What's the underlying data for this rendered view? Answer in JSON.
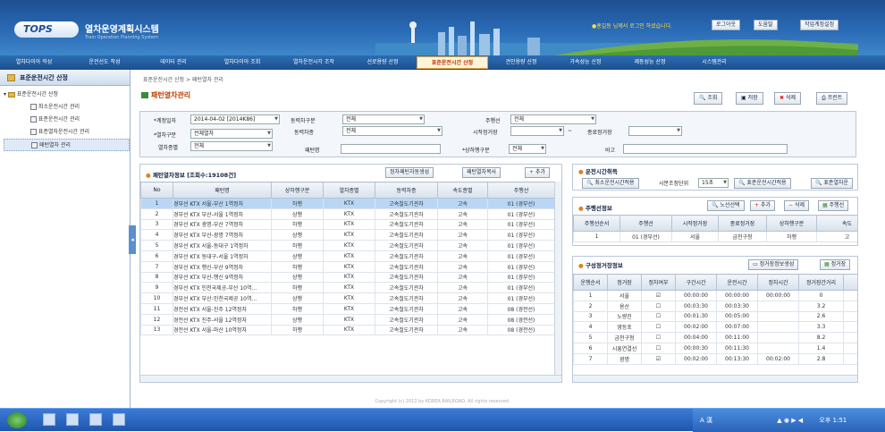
{
  "header": {
    "logo": "TOPS",
    "app_name": "열차운영계획시스템",
    "app_sub": "Train Operation Planning System",
    "welcome": "●홍길동 님께서 로그인 하셨습니다.",
    "buttons": [
      "로그아웃",
      "도움말",
      "작업계정설정"
    ]
  },
  "nav": {
    "items": [
      "열차다이아 작성",
      "운전선도 작성",
      "데이터 관리",
      "열차다이아 조회",
      "열차운전시각 조작",
      "선로용량 산정",
      "표준운전시간 산정",
      "견인용량 산정",
      "가속성능 산정",
      "제동성능 산정",
      "시스템관리"
    ],
    "active_index": 6
  },
  "sidebar": {
    "title": "표준운전시간 산정",
    "items": [
      {
        "label": "표준운전시간 산정",
        "level": 0
      },
      {
        "label": "최소운전시간 관리",
        "level": 1
      },
      {
        "label": "표준운전시간 관리",
        "level": 1
      },
      {
        "label": "표준열차운전시간 관리",
        "level": 1
      },
      {
        "label": "패턴열차 관리",
        "level": 1,
        "selected": true
      }
    ]
  },
  "breadcrumb": "표준운전시간 산정 > 패턴열차 관리",
  "page_title": "패턴열차관리",
  "toolbar": [
    "조회",
    "저장",
    "삭제",
    "프린트"
  ],
  "filter": {
    "date_label": "*계정일자",
    "date_value": "2014-04-02 [2014K86]",
    "train_type_label": "*열차구분",
    "train_type_value": "전체열차",
    "class_label": "열차종별",
    "class_value": "전체",
    "power_type_label": "동력차구분",
    "power_type_value": "전체",
    "power_car_label": "동력차종",
    "power_car_value": "전체",
    "pattern_label": "패턴명",
    "pattern_value": "",
    "line_label": "주행선",
    "line_value": "전체",
    "start_label": "시작정거장",
    "start_value": "",
    "end_label": "종료정거장",
    "end_value": "",
    "dir_label": "*상하행구분",
    "dir_value": "전체",
    "note_label": "비고",
    "note_value": ""
  },
  "pattern_panel": {
    "title": "패턴열차정보 [조회수:19108건]",
    "buttons": [
      "정차패턴자동생성",
      "패턴열차복사",
      "추가"
    ],
    "columns": [
      "No",
      "패턴명",
      "상하행구분",
      "열차종별",
      "동력차종",
      "속도종별",
      "주행선"
    ],
    "rows": [
      [
        "1",
        "경부선 KTX 서울-부산 1역정차",
        "하행",
        "KTX",
        "고속철도기관차",
        "고속",
        "01 (경부선)"
      ],
      [
        "2",
        "경부선 KTX 부산-서울 1역정차",
        "상행",
        "KTX",
        "고속철도기관차",
        "고속",
        "01 (경부선)"
      ],
      [
        "3",
        "경부선 KTX 광명-부산 7역정차",
        "하행",
        "KTX",
        "고속철도기관차",
        "고속",
        "01 (경부선)"
      ],
      [
        "4",
        "경부선 KTX 부산-광명 7역정차",
        "상행",
        "KTX",
        "고속철도기관차",
        "고속",
        "01 (경부선)"
      ],
      [
        "5",
        "경부선 KTX 서울-동대구 1역정차",
        "하행",
        "KTX",
        "고속철도기관차",
        "고속",
        "01 (경부선)"
      ],
      [
        "6",
        "경부선 KTX 동대구-서울 1역정차",
        "상행",
        "KTX",
        "고속철도기관차",
        "고속",
        "01 (경부선)"
      ],
      [
        "7",
        "경부선 KTX 행신-부산 9역정차",
        "하행",
        "KTX",
        "고속철도기관차",
        "고속",
        "01 (경부선)"
      ],
      [
        "8",
        "경부선 KTX 부산-행신 9역정차",
        "상행",
        "KTX",
        "고속철도기관차",
        "고속",
        "01 (경부선)"
      ],
      [
        "9",
        "경부선 KTX 인천국제공-부산 10역...",
        "하행",
        "KTX",
        "고속철도기관차",
        "고속",
        "01 (경부선)"
      ],
      [
        "10",
        "경부선 KTX 부산-인천국제공 10역...",
        "상행",
        "KTX",
        "고속철도기관차",
        "고속",
        "01 (경부선)"
      ],
      [
        "11",
        "경전선 KTX 서울-진주 12역정차",
        "하행",
        "KTX",
        "고속철도기관차",
        "고속",
        "08 (경전선)"
      ],
      [
        "12",
        "경전선 KTX 진주-서울 12역정차",
        "상행",
        "KTX",
        "고속철도기관차",
        "고속",
        "08 (경전선)"
      ],
      [
        "13",
        "경전선 KTX 서울-마산 10역정차",
        "하행",
        "KTX",
        "고속철도기관차",
        "고속",
        "08 (경전선)"
      ]
    ]
  },
  "run_time_panel": {
    "title": "운전시간취득",
    "buttons": [
      "최소운전시간적용",
      "표준운전시간적용",
      "표준열차운"
    ],
    "unit_label": "시분조정단위",
    "unit_value": "15초"
  },
  "route_panel": {
    "title": "주행선정보",
    "buttons": [
      "노선선택",
      "추가",
      "삭제",
      "주행선"
    ],
    "columns": [
      "주행선순서",
      "주행선",
      "시작정거장",
      "종료정거장",
      "상하행구분",
      "속도"
    ],
    "rows": [
      [
        "1",
        "01 (경부선)",
        "서울",
        "금천구청",
        "하행",
        "고"
      ]
    ]
  },
  "stop_panel": {
    "title": "구성정거장정보",
    "buttons": [
      "정거장정보생성",
      "정거장"
    ],
    "columns": [
      "운행순서",
      "정거장",
      "정차여부",
      "구간시간",
      "운전시간",
      "정차시간",
      "정거장간거리",
      "누"
    ],
    "rows": [
      [
        "1",
        "서울",
        true,
        "00:00:00",
        "00:00:00",
        "00:00:00",
        "0"
      ],
      [
        "2",
        "용산",
        false,
        "00:03:30",
        "00:03:30",
        "",
        "3.2"
      ],
      [
        "3",
        "노량진",
        false,
        "00:01:30",
        "00:05:00",
        "",
        "2.6"
      ],
      [
        "4",
        "영등포",
        false,
        "00:02:00",
        "00:07:00",
        "",
        "3.3"
      ],
      [
        "5",
        "금천구청",
        false,
        "00:04:00",
        "00:11:00",
        "",
        "8.2"
      ],
      [
        "6",
        "시흥연결선",
        false,
        "00:00:30",
        "00:11:30",
        "",
        "1.4"
      ],
      [
        "7",
        "광명",
        true,
        "00:02:00",
        "00:13:30",
        "00:02:00",
        "2.8"
      ]
    ]
  },
  "copyright": "Copyright (c) 2012 by KOREA RAILROAD. All rights reserved.",
  "taskbar": {
    "tray_text": "A 漢",
    "clock": "오후 1:51"
  }
}
